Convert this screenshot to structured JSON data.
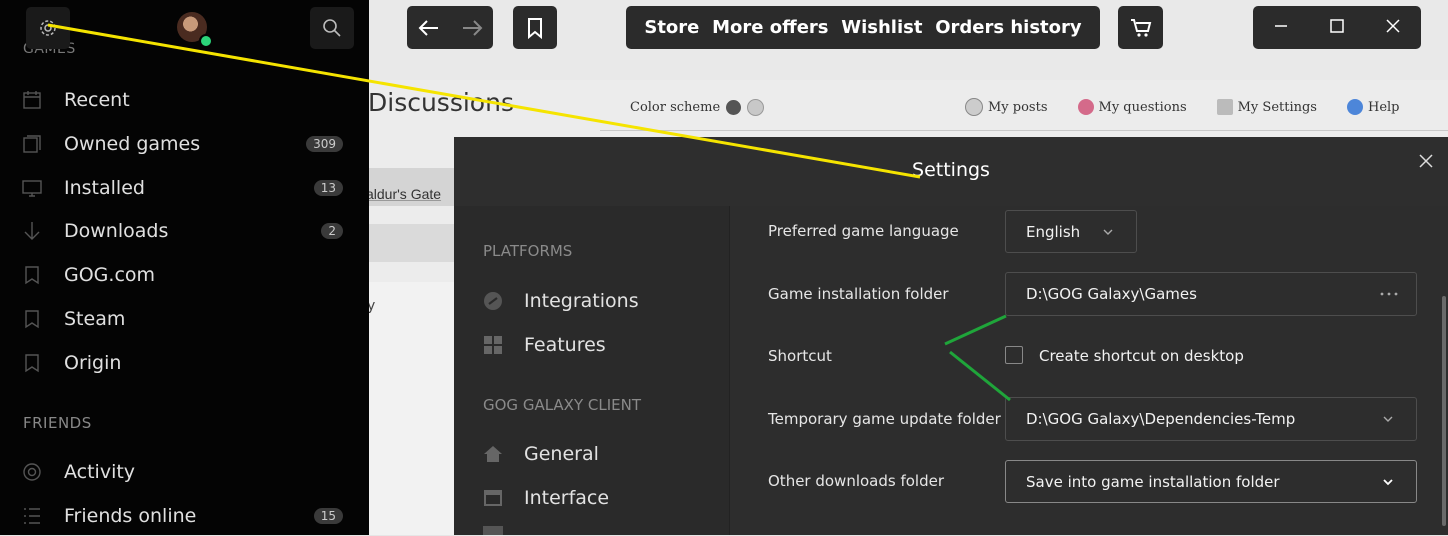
{
  "background_page": {
    "title": "Discussions",
    "color_scheme_label": "Color scheme",
    "links": [
      "My posts",
      "My questions",
      "My Settings",
      "Help"
    ],
    "thread_snippet": "aldur's Gate",
    "text_fragment": "y"
  },
  "toolbar": {
    "back_icon": "arrow-left-icon",
    "forward_icon": "arrow-right-icon",
    "bookmark_icon": "bookmark-icon",
    "store_nav": [
      "Store",
      "More offers",
      "Wishlist",
      "Orders history"
    ],
    "cart_icon": "cart-icon",
    "window_controls": [
      "minimize-icon",
      "maximize-icon",
      "close-icon"
    ]
  },
  "sidebar": {
    "games_header": "GAMES",
    "items": [
      {
        "label": "Recent",
        "icon": "calendar-icon",
        "count": ""
      },
      {
        "label": "Owned games",
        "icon": "library-icon",
        "count": "309"
      },
      {
        "label": "Installed",
        "icon": "monitor-icon",
        "count": "13"
      },
      {
        "label": "Downloads",
        "icon": "download-icon",
        "count": "2"
      },
      {
        "label": "GOG.com",
        "icon": "bookmark-icon",
        "count": ""
      },
      {
        "label": "Steam",
        "icon": "bookmark-icon",
        "count": ""
      },
      {
        "label": "Origin",
        "icon": "bookmark-icon",
        "count": ""
      }
    ],
    "friends_header": "FRIENDS",
    "friend_items": [
      {
        "label": "Activity",
        "icon": "activity-icon",
        "count": ""
      },
      {
        "label": "Friends online",
        "icon": "list-icon",
        "count": "15"
      }
    ]
  },
  "settings": {
    "title": "Settings",
    "side": {
      "platforms_header": "PLATFORMS",
      "platform_items": [
        {
          "label": "Integrations",
          "icon": "link-icon"
        },
        {
          "label": "Features",
          "icon": "grid-icon"
        }
      ],
      "client_header": "GOG GALAXY CLIENT",
      "client_items": [
        {
          "label": "General",
          "icon": "home-icon"
        },
        {
          "label": "Interface",
          "icon": "window-icon"
        }
      ]
    },
    "rows": {
      "language_label": "Preferred game language",
      "language_value": "English",
      "install_label": "Game installation folder",
      "install_value": "D:\\GOG Galaxy\\Games",
      "shortcut_label": "Shortcut",
      "shortcut_checkbox": "Create shortcut on desktop",
      "temp_label": "Temporary game update folder",
      "temp_value": "D:\\GOG Galaxy\\Dependencies-Temp",
      "other_label": "Other downloads folder",
      "other_value": "Save into game installation folder"
    }
  },
  "colors": {
    "sidebar_bg": "#040404",
    "modal_bg": "#2b2b2b",
    "annotation_yellow": "#f5e400",
    "annotation_green": "#1fa53a",
    "status_online": "#2bd47a"
  }
}
